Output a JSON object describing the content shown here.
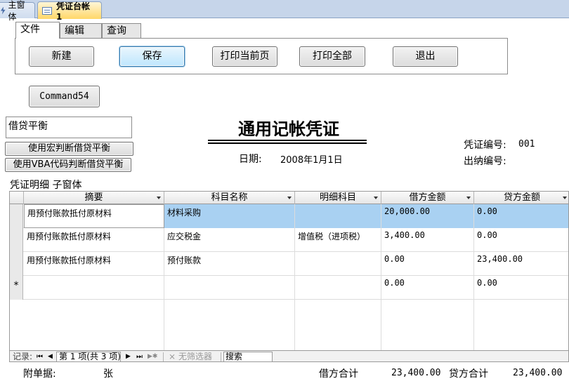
{
  "doc_tabs": {
    "main": "主窗体",
    "active": "凭证台帐1"
  },
  "tab_control": {
    "tabs": [
      "文件",
      "编辑",
      "查询"
    ]
  },
  "toolbar": {
    "new": "新建",
    "save": "保存",
    "print_current": "打印当前页",
    "print_all": "打印全部",
    "exit": "退出"
  },
  "command54": "Command54",
  "balance_textbox": "借贷平衡",
  "macro_check": "使用宏判断借贷平衡",
  "vba_check": "使用VBA代码判断借贷平衡",
  "title": "通用记帐凭证",
  "date_label": "日期:",
  "date_value": "2008年1月1日",
  "voucher_no_label": "凭证编号:",
  "voucher_no_value": "001",
  "cashier_no_label": "出纳编号:",
  "subform_label": "凭证明细 子窗体",
  "grid": {
    "columns": [
      "摘要",
      "科目名称",
      "明细科目",
      "借方金额",
      "贷方金额"
    ],
    "rows": [
      {
        "summary": "用预付账款抵付原材料",
        "account": "材料采购",
        "detail": "",
        "debit": "20,000.00",
        "credit": "0.00"
      },
      {
        "summary": "用预付账款抵付原材料",
        "account": "应交税金",
        "detail": "增值税（进项税）",
        "debit": "3,400.00",
        "credit": "0.00"
      },
      {
        "summary": "用预付账款抵付原材料",
        "account": "预付账款",
        "detail": "",
        "debit": "0.00",
        "credit": "23,400.00"
      }
    ],
    "new_row": {
      "marker": "*",
      "debit": "0.00",
      "credit": "0.00"
    }
  },
  "navbar": {
    "record_label": "记录:",
    "first": "⏮",
    "prev": "◀",
    "position": "第 1 项(共 3 项)",
    "next": "▶",
    "last": "⏭",
    "new": "▶✱",
    "filter": "无筛选器",
    "search": "搜索"
  },
  "footer": {
    "attachments_label": "附单据:",
    "attachments_value": "张",
    "debit_total_label": "借方合计",
    "debit_total_value": "23,400.00",
    "credit_total_label": "贷方合计",
    "credit_total_value": "23,400.00"
  }
}
